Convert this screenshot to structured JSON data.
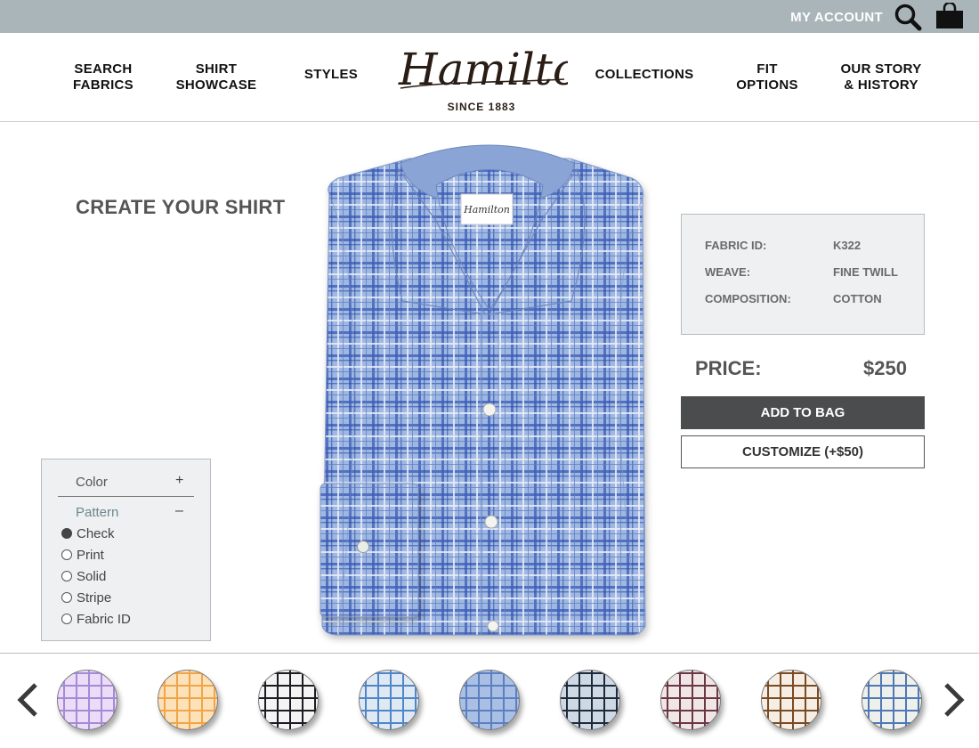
{
  "topbar": {
    "account_label": "MY ACCOUNT"
  },
  "nav": {
    "search_fabrics": [
      "SEARCH",
      "FABRICS"
    ],
    "shirt_showcase": [
      "SHIRT",
      "SHOWCASE"
    ],
    "styles": "STYLES",
    "collections": "COLLECTIONS",
    "fit_options": [
      "FIT",
      "OPTIONS"
    ],
    "our_story": [
      "OUR STORY",
      "& HISTORY"
    ]
  },
  "logo": {
    "wordmark": "Hamilton",
    "since": "SINCE 1883",
    "collar_label": "Hamilton"
  },
  "page": {
    "title": "CREATE YOUR SHIRT"
  },
  "fabric": {
    "rows": [
      {
        "label": "FABRIC ID:",
        "value": "K322"
      },
      {
        "label": "WEAVE:",
        "value": "FINE TWILL"
      },
      {
        "label": "COMPOSITION:",
        "value": "COTTON"
      }
    ]
  },
  "price": {
    "label": "PRICE:",
    "value": "$250"
  },
  "actions": {
    "add_to_bag": "ADD TO BAG",
    "customize": "CUSTOMIZE (+$50)"
  },
  "filter": {
    "color": {
      "label": "Color",
      "toggle": "+"
    },
    "pattern": {
      "label": "Pattern",
      "toggle": "–"
    },
    "options": [
      {
        "label": "Check",
        "selected": true
      },
      {
        "label": "Print",
        "selected": false
      },
      {
        "label": "Solid",
        "selected": false
      },
      {
        "label": "Stripe",
        "selected": false
      },
      {
        "label": "Fabric ID",
        "selected": false
      }
    ]
  },
  "swatches": [
    {
      "bg": "#ecdcf8",
      "line": "#a48bd8",
      "name": "lavender-check"
    },
    {
      "bg": "#fde1b8",
      "line": "#f0a54a",
      "name": "orange-check"
    },
    {
      "bg": "#f4f4f4",
      "line": "#1b1b22",
      "name": "black-gingham"
    },
    {
      "bg": "#dfe9f4",
      "line": "#4f86c8",
      "name": "blue-gingham"
    },
    {
      "bg": "#a9c0e4",
      "line": "#5d7fc0",
      "name": "blue-plaid"
    },
    {
      "bg": "#cfd9e6",
      "line": "#1e2a3a",
      "name": "navy-check"
    },
    {
      "bg": "#f0e6e6",
      "line": "#6b3744",
      "name": "burgundy-check"
    },
    {
      "bg": "#f6eee4",
      "line": "#7a4a22",
      "name": "brown-check"
    },
    {
      "bg": "#eef0ec",
      "line": "#4f78b5",
      "name": "tan-blue-check"
    }
  ]
}
